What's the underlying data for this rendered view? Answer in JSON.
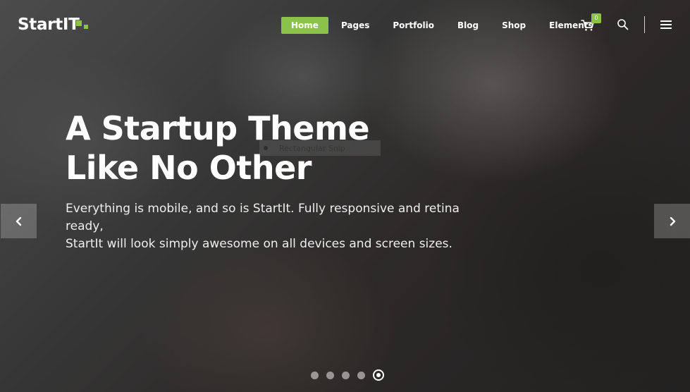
{
  "brand": {
    "logo_text": "StartIT",
    "accent_color": "#8bc34a"
  },
  "nav": {
    "items": [
      {
        "label": "Home",
        "active": true
      },
      {
        "label": "Pages"
      },
      {
        "label": "Portfolio"
      },
      {
        "label": "Blog"
      },
      {
        "label": "Shop"
      },
      {
        "label": "Elements"
      }
    ],
    "cart_count": "0",
    "icons": [
      "cart-icon",
      "search-icon",
      "menu-icon"
    ]
  },
  "hero": {
    "headline_line1": "A Startup Theme",
    "headline_line2": "Like No Other",
    "subtext_line1": "Everything is mobile, and so is StartIt. Fully responsive and retina ready,",
    "subtext_line2": "StartIt will look simply awesome on all devices and screen sizes.",
    "overlay_snip_label": "Rectangular Snip"
  },
  "slider": {
    "total_slides": 5,
    "active_slide": 5,
    "prev_icon": "chevron-left-icon",
    "next_icon": "chevron-right-icon"
  }
}
